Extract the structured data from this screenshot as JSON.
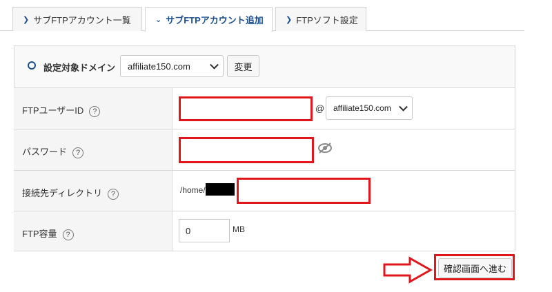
{
  "tabs": [
    {
      "label": "サブFTPアカウント一覧",
      "active": false
    },
    {
      "label": "サブFTPアカウント追加",
      "active": true
    },
    {
      "label": "FTPソフト設定",
      "active": false
    }
  ],
  "domain_row": {
    "label": "設定対象ドメイン",
    "selected": "affiliate150.com",
    "change_button": "変更"
  },
  "form": {
    "user_id_label": "FTPユーザーID",
    "at_sign": "@",
    "domain_select": "affiliate150.com",
    "password_label": "パスワード",
    "directory_label": "接続先ディレクトリ",
    "directory_prefix": "/home/",
    "capacity_label": "FTP容量",
    "capacity_value": "0",
    "capacity_unit": "MB",
    "help": "?"
  },
  "submit_button": "確認画面へ進む",
  "colors": {
    "highlight": "#e0161c",
    "tab_accent": "#1b4f8e",
    "label_bg": "#f5f5f5"
  }
}
